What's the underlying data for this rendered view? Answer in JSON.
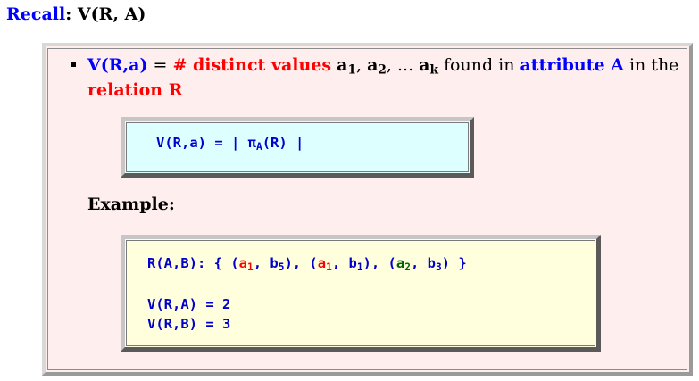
{
  "heading": {
    "label": "Recall",
    "sep": ": ",
    "text": "V(R, A)"
  },
  "bullet": {
    "t1": "V(R,a)",
    "t2": " = ",
    "t3": "# distinct values",
    "t4": " ",
    "a1": "a",
    "a1sub": "1",
    "c1": ", ",
    "a2": "a",
    "a2sub": "2",
    "c2": ", ... ",
    "ak": "a",
    "aksub": "k",
    "t5": " found in ",
    "t6": "attribute A",
    "t7": " in the ",
    "t8": "relation R"
  },
  "formula_box": {
    "pre": "V(R,a) = | π",
    "sub": "A",
    "post": "(R) |"
  },
  "example_label": "Example:",
  "example_box": {
    "rel_pre": "R(A,B): { (",
    "v1": "a",
    "v1sub": "1",
    "s1": ", b",
    "s1sub": "5",
    "s1b": "), (",
    "v2": "a",
    "v2sub": "1",
    "s2": ", b",
    "s2sub": "1",
    "s2b": "), (",
    "v3": "a",
    "v3sub": "2",
    "s3": ", b",
    "s3sub": "3",
    "s3b": ") }",
    "line2": "V(R,A) = 2",
    "line3": "V(R,B) = 3"
  },
  "colors": {
    "blue": "#0000ff",
    "red": "#ff0000",
    "green": "#006400",
    "outer_bg": "#ffeeee",
    "box1_bg": "#ddffff",
    "box2_bg": "#ffffdd"
  }
}
